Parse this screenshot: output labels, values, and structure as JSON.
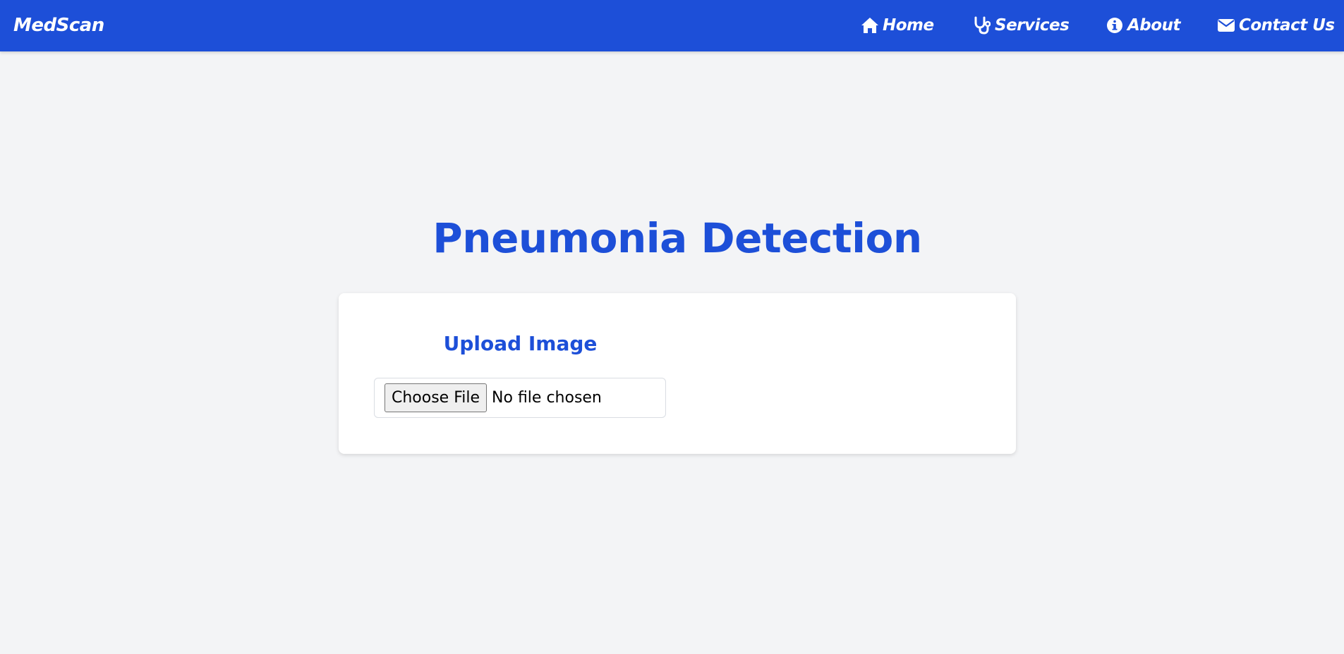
{
  "header": {
    "brand": "MedScan",
    "nav": [
      {
        "label": "Home",
        "icon": "home-icon"
      },
      {
        "label": "Services",
        "icon": "stethoscope-icon"
      },
      {
        "label": "About",
        "icon": "info-circle-icon"
      },
      {
        "label": "Contact Us",
        "icon": "envelope-icon"
      }
    ]
  },
  "main": {
    "title": "Pneumonia Detection",
    "upload": {
      "heading": "Upload Image",
      "button_label": "Choose File",
      "status": "No file chosen"
    }
  },
  "colors": {
    "accent": "#1d4fd8",
    "background": "#f3f4f6",
    "card": "#ffffff"
  }
}
